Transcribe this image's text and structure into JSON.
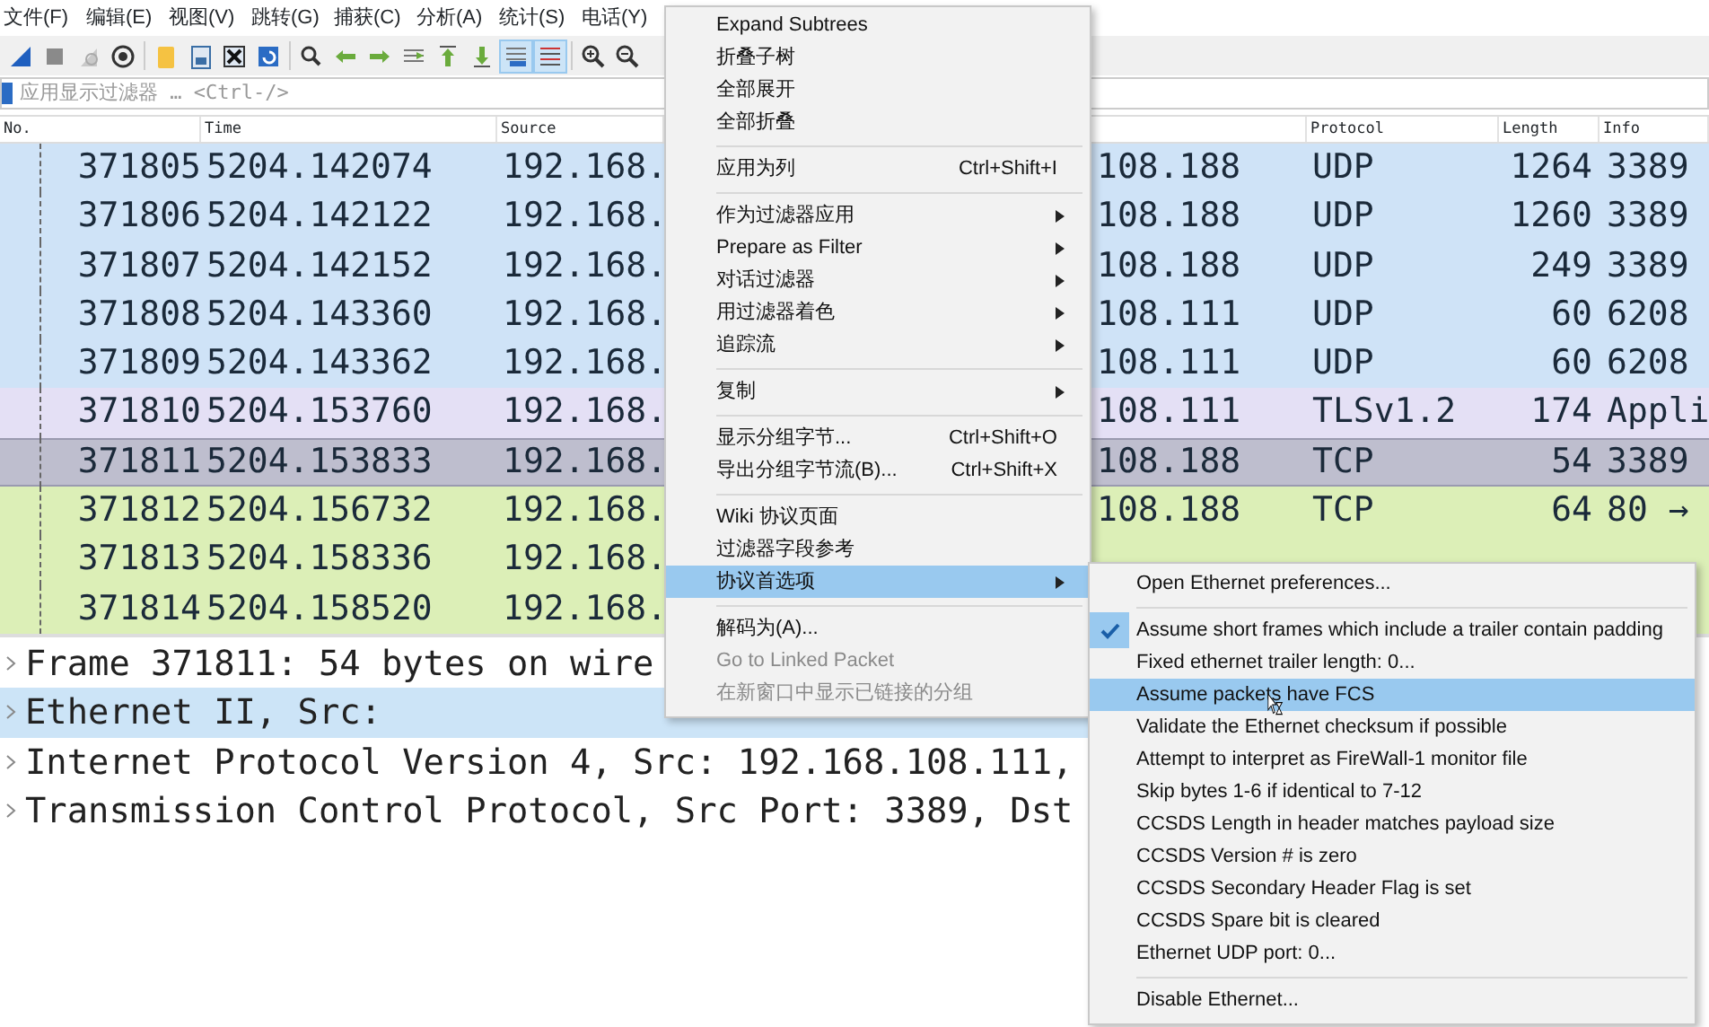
{
  "menubar": [
    {
      "label": "文件(F)"
    },
    {
      "label": "编辑(E)"
    },
    {
      "label": "视图(V)"
    },
    {
      "label": "跳转(G)"
    },
    {
      "label": "捕获(C)"
    },
    {
      "label": "分析(A)"
    },
    {
      "label": "统计(S)"
    },
    {
      "label": "电话(Y)"
    }
  ],
  "toolbar": [
    {
      "pressed": false
    },
    {
      "pressed": false
    },
    {
      "pressed": false
    },
    {
      "pressed": false
    },
    {
      "pressed": false
    },
    {
      "pressed": false
    },
    {
      "pressed": false
    },
    {
      "pressed": false
    },
    {
      "pressed": false
    },
    {
      "pressed": false
    },
    {
      "pressed": false
    },
    {
      "pressed": false
    },
    {
      "pressed": false
    },
    {
      "pressed": false
    },
    {
      "pressed": true
    },
    {
      "pressed": true
    },
    {
      "pressed": false
    },
    {
      "pressed": false
    }
  ],
  "filter": {
    "placeholder": "应用显示过滤器 … <Ctrl-/>"
  },
  "columns": [
    {
      "label": "No."
    },
    {
      "label": "Time"
    },
    {
      "label": "Source"
    },
    {
      "label": "Protocol"
    },
    {
      "label": "Length"
    },
    {
      "label": "Info"
    }
  ],
  "packets": [
    {
      "no": "371805",
      "time": "5204.142074",
      "source": "192.168.",
      "destination": "108.188",
      "protocol": "UDP",
      "length": "1264",
      "info": "3389",
      "color": "#cfe3f7",
      "selected": false
    },
    {
      "no": "371806",
      "time": "5204.142122",
      "source": "192.168.",
      "destination": "108.188",
      "protocol": "UDP",
      "length": "1260",
      "info": "3389",
      "color": "#cfe3f7",
      "selected": false
    },
    {
      "no": "371807",
      "time": "5204.142152",
      "source": "192.168.",
      "destination": "108.188",
      "protocol": "UDP",
      "length": "249",
      "info": "3389",
      "color": "#cfe3f7",
      "selected": false
    },
    {
      "no": "371808",
      "time": "5204.143360",
      "source": "192.168.",
      "destination": "108.111",
      "protocol": "UDP",
      "length": "60",
      "info": "6208",
      "color": "#cfe3f7",
      "selected": false
    },
    {
      "no": "371809",
      "time": "5204.143362",
      "source": "192.168.",
      "destination": "108.111",
      "protocol": "UDP",
      "length": "60",
      "info": "6208",
      "color": "#cfe3f7",
      "selected": false
    },
    {
      "no": "371810",
      "time": "5204.153760",
      "source": "192.168.",
      "destination": "108.111",
      "protocol": "TLSv1.2",
      "length": "174",
      "info": "Appli",
      "color": "#e4e0f5",
      "selected": false
    },
    {
      "no": "371811",
      "time": "5204.153833",
      "source": "192.168.",
      "destination": "108.188",
      "protocol": "TCP",
      "length": "54",
      "info": "3389",
      "color": "#bebece",
      "selected": true
    },
    {
      "no": "371812",
      "time": "5204.156732",
      "source": "192.168.",
      "destination": "108.188",
      "protocol": "TCP",
      "length": "64",
      "info": "80 →",
      "color": "#dcefb7",
      "selected": false
    },
    {
      "no": "371813",
      "time": "5204.158336",
      "source": "192.168.",
      "color": "#dcefb7",
      "selected": false
    },
    {
      "no": "371814",
      "time": "5204.158520",
      "source": "192.168.",
      "color": "#dcefb7",
      "selected": false
    }
  ],
  "details": [
    {
      "text": "Frame 371811: 54 bytes on wire",
      "expanded": false,
      "selected": false
    },
    {
      "text": "Ethernet II, Src:",
      "expanded": false,
      "selected": true
    },
    {
      "text": "Internet Protocol Version 4, Src: 192.168.108.111,",
      "expanded": false,
      "selected": false
    },
    {
      "text": "Transmission Control Protocol, Src Port: 3389, Dst",
      "expanded": false,
      "selected": false
    }
  ],
  "context_menu": [
    {
      "kind": "item",
      "label": "Expand Subtrees"
    },
    {
      "kind": "item",
      "label": "折叠子树"
    },
    {
      "kind": "item",
      "label": "全部展开"
    },
    {
      "kind": "item",
      "label": "全部折叠"
    },
    {
      "kind": "separator"
    },
    {
      "kind": "item",
      "label": "应用为列",
      "shortcut": "Ctrl+Shift+I"
    },
    {
      "kind": "separator"
    },
    {
      "kind": "submenu",
      "label": "作为过滤器应用"
    },
    {
      "kind": "submenu",
      "label": "Prepare as Filter"
    },
    {
      "kind": "submenu",
      "label": "对话过滤器"
    },
    {
      "kind": "submenu",
      "label": "用过滤器着色"
    },
    {
      "kind": "submenu",
      "label": "追踪流"
    },
    {
      "kind": "separator"
    },
    {
      "kind": "submenu",
      "label": "复制"
    },
    {
      "kind": "separator"
    },
    {
      "kind": "item",
      "label": "显示分组字节...",
      "shortcut": "Ctrl+Shift+O"
    },
    {
      "kind": "item",
      "label": "导出分组字节流(B)...",
      "shortcut": "Ctrl+Shift+X"
    },
    {
      "kind": "separator"
    },
    {
      "kind": "item",
      "label": "Wiki 协议页面"
    },
    {
      "kind": "item",
      "label": "过滤器字段参考"
    },
    {
      "kind": "submenu",
      "label": "协议首选项",
      "selected": true
    },
    {
      "kind": "separator"
    },
    {
      "kind": "item",
      "label": "解码为(A)..."
    },
    {
      "kind": "item",
      "label": "Go to Linked Packet",
      "disabled": true
    },
    {
      "kind": "item",
      "label": "在新窗口中显示已链接的分组",
      "disabled": true
    }
  ],
  "submenu": [
    {
      "kind": "item",
      "label": "Open Ethernet preferences..."
    },
    {
      "kind": "separator"
    },
    {
      "kind": "check",
      "label": "Assume short frames which include a trailer contain padding",
      "checked": true
    },
    {
      "kind": "item",
      "label": "Fixed ethernet trailer length: 0..."
    },
    {
      "kind": "check",
      "label": "Assume packets have FCS",
      "checked": false,
      "selected": true
    },
    {
      "kind": "check",
      "label": "Validate the Ethernet checksum if possible",
      "checked": false
    },
    {
      "kind": "check",
      "label": "Attempt to interpret as FireWall-1 monitor file",
      "checked": false
    },
    {
      "kind": "check",
      "label": "Skip bytes 1-6 if identical to 7-12",
      "checked": false
    },
    {
      "kind": "check",
      "label": "CCSDS Length in header matches payload size",
      "checked": false
    },
    {
      "kind": "check",
      "label": "CCSDS Version # is zero",
      "checked": false
    },
    {
      "kind": "check",
      "label": "CCSDS Secondary Header Flag is set",
      "checked": false
    },
    {
      "kind": "check",
      "label": "CCSDS Spare bit is cleared",
      "checked": false
    },
    {
      "kind": "item",
      "label": "Ethernet UDP port: 0..."
    },
    {
      "kind": "separator"
    },
    {
      "kind": "item",
      "label": "Disable Ethernet..."
    }
  ]
}
